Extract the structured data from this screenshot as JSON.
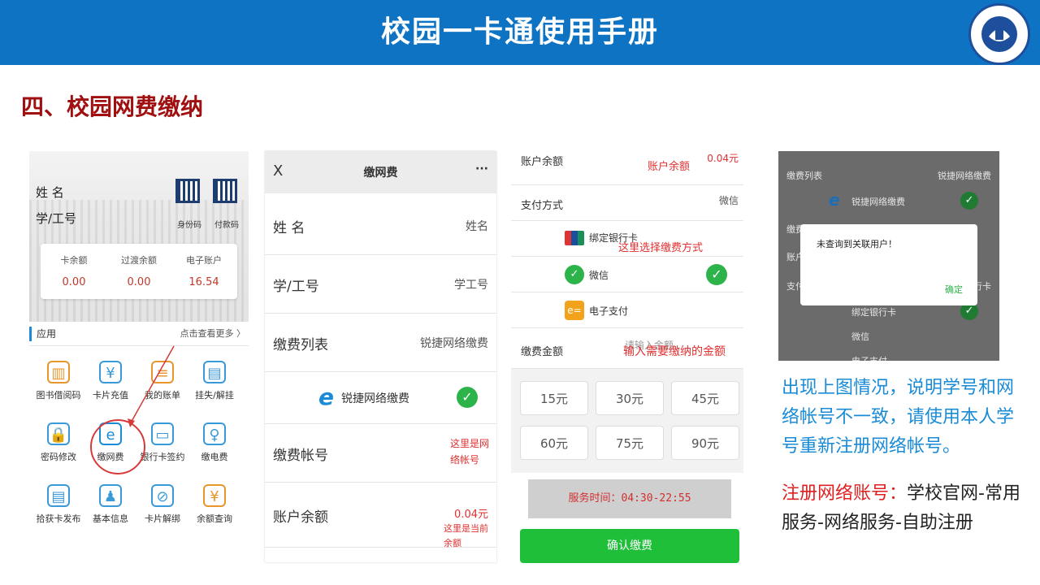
{
  "header": {
    "title": "校园一卡通使用手册",
    "bg": "#0f73c4"
  },
  "section": {
    "title": "四、校园网费缴纳"
  },
  "p1": {
    "name_label": "姓 名",
    "id_label": "学/工号",
    "qr1": "身份码",
    "qr2": "付款码",
    "balances": [
      {
        "label": "卡余额",
        "value": "0.00"
      },
      {
        "label": "过渡余额",
        "value": "0.00"
      },
      {
        "label": "电子账户",
        "value": "16.54"
      }
    ],
    "apps_title": "应用",
    "more": "点击查看更多 〉",
    "apps": [
      {
        "label": "图书借阅码",
        "icon": "barcode-icon",
        "glyph": "▥",
        "color": "#e8962c"
      },
      {
        "label": "卡片充值",
        "icon": "yen-icon",
        "glyph": "¥",
        "color": "#3a9ad9"
      },
      {
        "label": "我的账单",
        "icon": "bill-icon",
        "glyph": "≡",
        "color": "#e8962c"
      },
      {
        "label": "挂失/解挂",
        "icon": "card-lock-icon",
        "glyph": "▤",
        "color": "#3a9ad9"
      },
      {
        "label": "密码修改",
        "icon": "lock-icon",
        "glyph": "🔒",
        "color": "#3a9ad9"
      },
      {
        "label": "缴网费",
        "icon": "ie-icon",
        "glyph": "e",
        "color": "#1a8bd6"
      },
      {
        "label": "银行卡签约",
        "icon": "bank-card-icon",
        "glyph": "▭",
        "color": "#3a9ad9"
      },
      {
        "label": "缴电费",
        "icon": "bulb-icon",
        "glyph": "♀",
        "color": "#3a9ad9"
      },
      {
        "label": "拾获卡发布",
        "icon": "card-found-icon",
        "glyph": "▤",
        "color": "#3a9ad9"
      },
      {
        "label": "基本信息",
        "icon": "user-icon",
        "glyph": "♟",
        "color": "#3a9ad9"
      },
      {
        "label": "卡片解绑",
        "icon": "unlink-icon",
        "glyph": "⊘",
        "color": "#3a9ad9"
      },
      {
        "label": "余额查询",
        "icon": "balance-icon",
        "glyph": "¥",
        "color": "#e8962c"
      }
    ]
  },
  "p2": {
    "close": "X",
    "title": "缴网费",
    "menu": "···",
    "rows": [
      {
        "k": "姓 名",
        "v": "姓名",
        "red": true
      },
      {
        "k": "学/工号",
        "v": "学工号",
        "red": true
      },
      {
        "k": "缴费列表",
        "v": "锐捷网络缴费",
        "red": false
      }
    ],
    "provider": "锐捷网络缴费",
    "account_k": "缴费帐号",
    "account_v": "这里是网络帐号",
    "bal_k": "账户余额",
    "bal_v": "0.04元",
    "bal_note": "这里是当前余额"
  },
  "p3": {
    "bal_k": "账户余额",
    "bal_v": "0.04元",
    "bal_note": "账户余额",
    "pay_k": "支付方式",
    "pay_v": "微信",
    "pay_note": "这里选择缴费方式",
    "options": [
      {
        "label": "绑定银行卡",
        "icon": "unionpay-icon"
      },
      {
        "label": "微信",
        "icon": "wechat-icon"
      },
      {
        "label": "电子支付",
        "icon": "epay-icon"
      }
    ],
    "amt_k": "缴费金额",
    "amt_placeholder": "请输入金额",
    "amt_note": "输入需要缴纳的金额",
    "amounts": [
      "15元",
      "30元",
      "45元",
      "60元",
      "75元",
      "90元"
    ],
    "service": "服务时间：04:30-22:55",
    "confirm": "确认缴费"
  },
  "p4": {
    "list_k": "缴费列表",
    "list_v": "锐捷网络缴费",
    "provider": "锐捷网络缴费",
    "k2": "缴费",
    "k3": "账户",
    "k4": "支付",
    "k4v": "行卡",
    "opt1": "绑定银行卡",
    "opt2": "微信",
    "opt3": "电子支付",
    "dialog_msg": "未查询到关联用户！",
    "dialog_ok": "确定"
  },
  "note": {
    "text": "出现上图情况，说明学号和网络帐号不一致，请使用本人学号重新注册网络帐号。",
    "reg_label": "注册网络账号：",
    "reg_path": "学校官网-常用服务-网络服务-自助注册"
  }
}
